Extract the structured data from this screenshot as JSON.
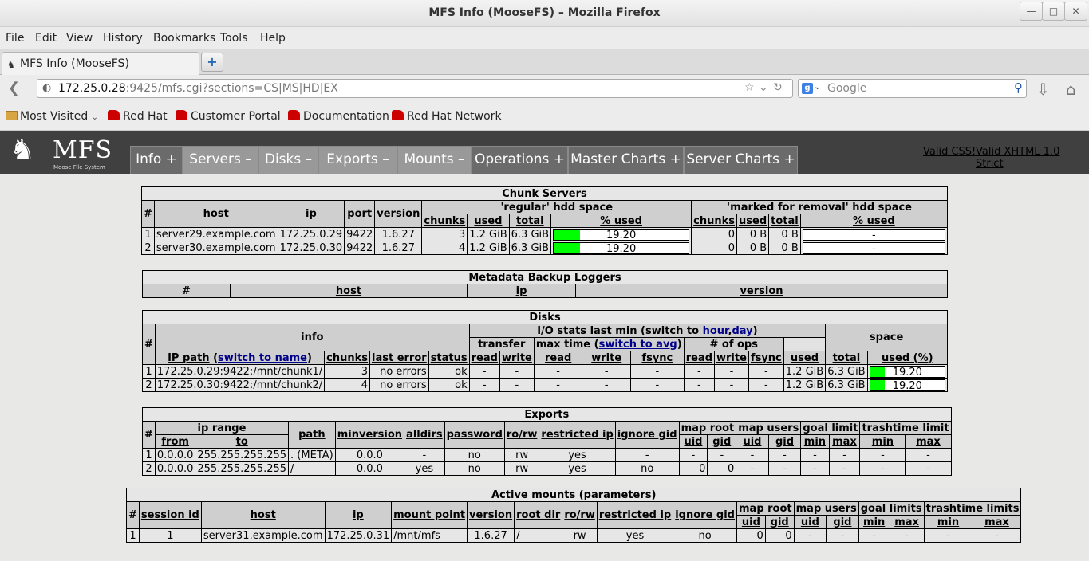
{
  "window": {
    "title": "MFS Info (MooseFS) – Mozilla Firefox"
  },
  "menu": [
    "File",
    "Edit",
    "View",
    "History",
    "Bookmarks",
    "Tools",
    "Help"
  ],
  "tab": {
    "label": "MFS Info (MooseFS)"
  },
  "url": {
    "host": "172.25.0.28",
    "rest": ":9425/mfs.cgi?sections=CS|MS|HD|EX"
  },
  "search": {
    "placeholder": "Google"
  },
  "bookmarks": [
    "Most Visited",
    "Red Hat",
    "Customer Portal",
    "Documentation",
    "Red Hat Network"
  ],
  "mfs": {
    "logo_text": "MFS",
    "logo_sub": "Moose File System",
    "tabs": [
      {
        "label": "Info +",
        "on": false
      },
      {
        "label": "Servers –",
        "on": true
      },
      {
        "label": "Disks –",
        "on": true
      },
      {
        "label": "Exports –",
        "on": true
      },
      {
        "label": "Mounts –",
        "on": true
      },
      {
        "label": "Operations +",
        "on": false
      },
      {
        "label": "Master Charts +",
        "on": false
      },
      {
        "label": "Server Charts +",
        "on": false
      }
    ],
    "valid_css": "Valid CSS!",
    "valid_xhtml": "Valid XHTML 1.0 Strict"
  },
  "chunk_servers": {
    "title": "Chunk Servers",
    "h": {
      "num": "#",
      "host": "host",
      "ip": "ip",
      "port": "port",
      "version": "version",
      "regular": "'regular' hdd space",
      "removal": "'marked for removal' hdd space",
      "chunks": "chunks",
      "used": "used",
      "total": "total",
      "pct": "% used"
    },
    "rows": [
      {
        "n": "1",
        "host": "server29.example.com",
        "ip": "172.25.0.29",
        "port": "9422",
        "version": "1.6.27",
        "chunks": "3",
        "used": "1.2 GiB",
        "total": "6.3 GiB",
        "pct": "19.20",
        "pct_value": 19.2,
        "rchunks": "0",
        "rused": "0 B",
        "rtotal": "0 B",
        "rpct": "-"
      },
      {
        "n": "2",
        "host": "server30.example.com",
        "ip": "172.25.0.30",
        "port": "9422",
        "version": "1.6.27",
        "chunks": "4",
        "used": "1.2 GiB",
        "total": "6.3 GiB",
        "pct": "19.20",
        "pct_value": 19.2,
        "rchunks": "0",
        "rused": "0 B",
        "rtotal": "0 B",
        "rpct": "-"
      }
    ]
  },
  "metaloggers": {
    "title": "Metadata Backup Loggers",
    "h": {
      "num": "#",
      "host": "host",
      "ip": "ip",
      "version": "version"
    }
  },
  "disks": {
    "title": "Disks",
    "h": {
      "num": "#",
      "info": "info",
      "io_pre": "I/O stats last min (switch to ",
      "hour": "hour",
      "comma": ",",
      "day": "day",
      "io_post": ")",
      "space": "space",
      "ip_path": "IP path",
      "switch_name_pre": " (",
      "switch_name": "switch to name",
      "switch_name_post": ")",
      "chunks": "chunks",
      "last_error": "last error",
      "status": "status",
      "transfer": "transfer",
      "maxtime_pre": "max time (",
      "switch_avg": "switch to avg",
      "maxtime_post": ")",
      "ops": "# of ops",
      "read": "read",
      "write": "write",
      "fsync": "fsync",
      "used": "used",
      "total": "total",
      "used_pct": "used (%)"
    },
    "rows": [
      {
        "n": "1",
        "path": "172.25.0.29:9422:/mnt/chunk1/",
        "chunks": "3",
        "err": "no errors",
        "status": "ok",
        "d": "-",
        "used": "1.2 GiB",
        "total": "6.3 GiB",
        "pct": "19.20",
        "pct_value": 19.2
      },
      {
        "n": "2",
        "path": "172.25.0.30:9422:/mnt/chunk2/",
        "chunks": "4",
        "err": "no errors",
        "status": "ok",
        "d": "-",
        "used": "1.2 GiB",
        "total": "6.3 GiB",
        "pct": "19.20",
        "pct_value": 19.2
      }
    ]
  },
  "exports": {
    "title": "Exports",
    "h": {
      "num": "#",
      "ip_range": "ip range",
      "from": "from",
      "to": "to",
      "path": "path",
      "minversion": "minversion",
      "alldirs": "alldirs",
      "password": "password",
      "rorw": "ro/rw",
      "restricted_ip": "restricted ip",
      "ignore_gid": "ignore gid",
      "map_root": "map root",
      "map_users": "map users",
      "goal_limit": "goal limit",
      "trashtime_limit": "trashtime limit",
      "uid": "uid",
      "gid": "gid",
      "min": "min",
      "max": "max"
    },
    "rows": [
      {
        "n": "1",
        "from": "0.0.0.0",
        "to": "255.255.255.255",
        "path": ". (META)",
        "minversion": "0.0.0",
        "alldirs": "-",
        "password": "no",
        "rorw": "rw",
        "restricted_ip": "yes",
        "ignore_gid": "-",
        "ru": "-",
        "rg": "-",
        "uu": "-",
        "ug": "-",
        "gmin": "-",
        "gmax": "-",
        "tmin": "-",
        "tmax": "-"
      },
      {
        "n": "2",
        "from": "0.0.0.0",
        "to": "255.255.255.255",
        "path": "/",
        "minversion": "0.0.0",
        "alldirs": "yes",
        "password": "no",
        "rorw": "rw",
        "restricted_ip": "yes",
        "ignore_gid": "no",
        "ru": "0",
        "rg": "0",
        "uu": "-",
        "ug": "-",
        "gmin": "-",
        "gmax": "-",
        "tmin": "-",
        "tmax": "-"
      }
    ]
  },
  "mounts": {
    "title": "Active mounts (parameters)",
    "h": {
      "num": "#",
      "session_id": "session id",
      "host": "host",
      "ip": "ip",
      "mount_point": "mount point",
      "version": "version",
      "root_dir": "root dir",
      "rorw": "ro/rw",
      "restricted_ip": "restricted ip",
      "ignore_gid": "ignore gid",
      "map_root": "map root",
      "map_users": "map users",
      "goal_limits": "goal limits",
      "trashtime_limits": "trashtime limits",
      "uid": "uid",
      "gid": "gid",
      "min": "min",
      "max": "max"
    },
    "rows": [
      {
        "n": "1",
        "session_id": "1",
        "host": "server31.example.com",
        "ip": "172.25.0.31",
        "mount_point": "/mnt/mfs",
        "version": "1.6.27",
        "root_dir": "/",
        "rorw": "rw",
        "restricted_ip": "yes",
        "ignore_gid": "no",
        "ru": "0",
        "rg": "0",
        "uu": "-",
        "ug": "-",
        "gmin": "-",
        "gmax": "-",
        "tmin": "-",
        "tmax": "-"
      }
    ]
  },
  "colors": {
    "bar_fill": "#00ff00",
    "header_bg": "#404040",
    "tab_bg": "#6b6b6b",
    "tab_on_bg": "#999999"
  }
}
